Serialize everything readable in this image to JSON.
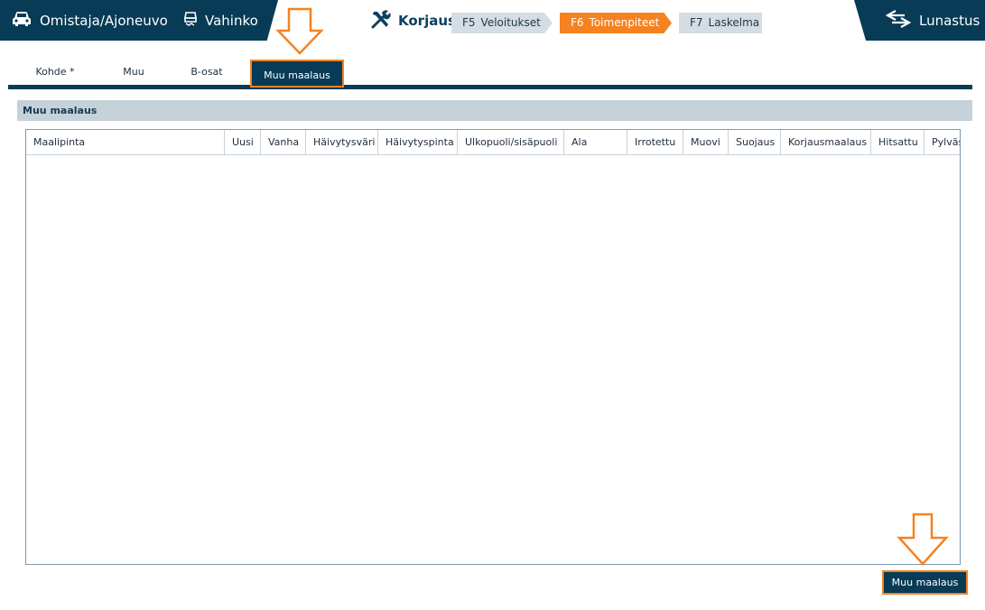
{
  "topbar": {
    "owner_vehicle": "Omistaja/Ajoneuvo",
    "damage": "Vahinko",
    "repair": "Korjaus",
    "steps": [
      {
        "key": "F5",
        "label": "Veloitukset"
      },
      {
        "key": "F6",
        "label": "Toimenpiteet"
      },
      {
        "key": "F7",
        "label": "Laskelma"
      }
    ],
    "redemption": "Lunastus"
  },
  "tabs": [
    {
      "label": "Kohde *"
    },
    {
      "label": "Muu"
    },
    {
      "label": "B-osat"
    },
    {
      "label": "Muu maalaus"
    }
  ],
  "section": {
    "title": "Muu maalaus",
    "columns": [
      "Maalipinta",
      "Uusi",
      "Vanha",
      "Häivytysväri",
      "Häivytyspinta",
      "Ulkopuoli/sisäpuoli",
      "Ala",
      "Irrotettu",
      "Muovi",
      "Suojaus",
      "Korjausmaalaus",
      "Hitsattu",
      "Pylväs"
    ]
  },
  "button": {
    "label": "Muu maalaus"
  },
  "colors": {
    "brand": "#073b56",
    "accent": "#f58220",
    "step_inactive": "#d3dde3",
    "section_bg": "#c5d2da"
  },
  "icons": {
    "owner_vehicle": "car-icon",
    "damage": "wrecked-car-icon",
    "repair": "tools-icon",
    "redemption": "exchange-arrows-icon"
  }
}
